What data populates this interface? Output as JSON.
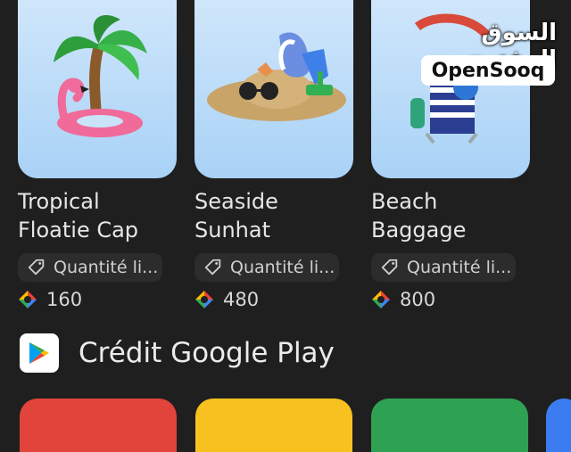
{
  "products": [
    {
      "title_line1": "Tropical",
      "title_line2": "Floatie Cap",
      "tag": "Quantité li...",
      "price": "160",
      "image_icon": "palm-tree-flamingo-icon"
    },
    {
      "title_line1": "Seaside",
      "title_line2": "Sunhat",
      "tag": "Quantité li...",
      "price": "480",
      "image_icon": "sunhat-icon"
    },
    {
      "title_line1": "Beach",
      "title_line2": "Baggage",
      "tag": "Quantité li...",
      "price": "800",
      "image_icon": "beach-chair-icon"
    }
  ],
  "section": {
    "title": "Crédit Google Play",
    "icon": "google-play-icon"
  },
  "gift_cards": [
    {
      "color": "#e0443a"
    },
    {
      "color": "#f7c21f"
    },
    {
      "color": "#2fa152"
    },
    {
      "color": "#3b7cf0"
    }
  ],
  "watermark": {
    "arabic": "السوق المفتوح",
    "latin": "OpenSooq"
  },
  "colors": {
    "background": "#1f1f1f",
    "card_bg": "#b9dcf9",
    "chip_bg": "#2c2c2c"
  }
}
